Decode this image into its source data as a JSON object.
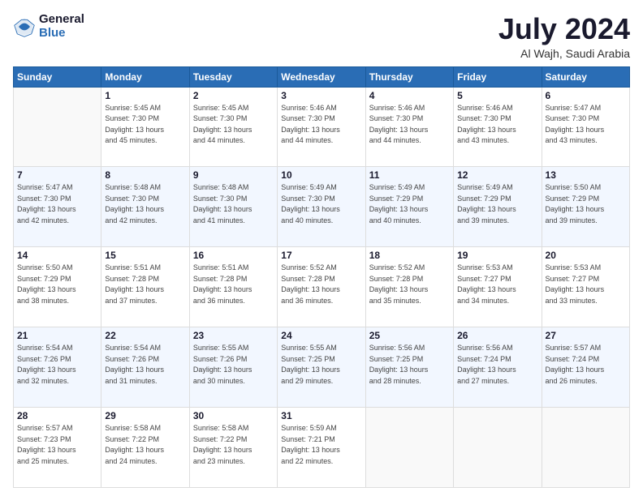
{
  "logo": {
    "general": "General",
    "blue": "Blue"
  },
  "title": "July 2024",
  "subtitle": "Al Wajh, Saudi Arabia",
  "days_header": [
    "Sunday",
    "Monday",
    "Tuesday",
    "Wednesday",
    "Thursday",
    "Friday",
    "Saturday"
  ],
  "weeks": [
    [
      {
        "day": "",
        "info": ""
      },
      {
        "day": "1",
        "info": "Sunrise: 5:45 AM\nSunset: 7:30 PM\nDaylight: 13 hours\nand 45 minutes."
      },
      {
        "day": "2",
        "info": "Sunrise: 5:45 AM\nSunset: 7:30 PM\nDaylight: 13 hours\nand 44 minutes."
      },
      {
        "day": "3",
        "info": "Sunrise: 5:46 AM\nSunset: 7:30 PM\nDaylight: 13 hours\nand 44 minutes."
      },
      {
        "day": "4",
        "info": "Sunrise: 5:46 AM\nSunset: 7:30 PM\nDaylight: 13 hours\nand 44 minutes."
      },
      {
        "day": "5",
        "info": "Sunrise: 5:46 AM\nSunset: 7:30 PM\nDaylight: 13 hours\nand 43 minutes."
      },
      {
        "day": "6",
        "info": "Sunrise: 5:47 AM\nSunset: 7:30 PM\nDaylight: 13 hours\nand 43 minutes."
      }
    ],
    [
      {
        "day": "7",
        "info": "Sunrise: 5:47 AM\nSunset: 7:30 PM\nDaylight: 13 hours\nand 42 minutes."
      },
      {
        "day": "8",
        "info": "Sunrise: 5:48 AM\nSunset: 7:30 PM\nDaylight: 13 hours\nand 42 minutes."
      },
      {
        "day": "9",
        "info": "Sunrise: 5:48 AM\nSunset: 7:30 PM\nDaylight: 13 hours\nand 41 minutes."
      },
      {
        "day": "10",
        "info": "Sunrise: 5:49 AM\nSunset: 7:30 PM\nDaylight: 13 hours\nand 40 minutes."
      },
      {
        "day": "11",
        "info": "Sunrise: 5:49 AM\nSunset: 7:29 PM\nDaylight: 13 hours\nand 40 minutes."
      },
      {
        "day": "12",
        "info": "Sunrise: 5:49 AM\nSunset: 7:29 PM\nDaylight: 13 hours\nand 39 minutes."
      },
      {
        "day": "13",
        "info": "Sunrise: 5:50 AM\nSunset: 7:29 PM\nDaylight: 13 hours\nand 39 minutes."
      }
    ],
    [
      {
        "day": "14",
        "info": "Sunrise: 5:50 AM\nSunset: 7:29 PM\nDaylight: 13 hours\nand 38 minutes."
      },
      {
        "day": "15",
        "info": "Sunrise: 5:51 AM\nSunset: 7:28 PM\nDaylight: 13 hours\nand 37 minutes."
      },
      {
        "day": "16",
        "info": "Sunrise: 5:51 AM\nSunset: 7:28 PM\nDaylight: 13 hours\nand 36 minutes."
      },
      {
        "day": "17",
        "info": "Sunrise: 5:52 AM\nSunset: 7:28 PM\nDaylight: 13 hours\nand 36 minutes."
      },
      {
        "day": "18",
        "info": "Sunrise: 5:52 AM\nSunset: 7:28 PM\nDaylight: 13 hours\nand 35 minutes."
      },
      {
        "day": "19",
        "info": "Sunrise: 5:53 AM\nSunset: 7:27 PM\nDaylight: 13 hours\nand 34 minutes."
      },
      {
        "day": "20",
        "info": "Sunrise: 5:53 AM\nSunset: 7:27 PM\nDaylight: 13 hours\nand 33 minutes."
      }
    ],
    [
      {
        "day": "21",
        "info": "Sunrise: 5:54 AM\nSunset: 7:26 PM\nDaylight: 13 hours\nand 32 minutes."
      },
      {
        "day": "22",
        "info": "Sunrise: 5:54 AM\nSunset: 7:26 PM\nDaylight: 13 hours\nand 31 minutes."
      },
      {
        "day": "23",
        "info": "Sunrise: 5:55 AM\nSunset: 7:26 PM\nDaylight: 13 hours\nand 30 minutes."
      },
      {
        "day": "24",
        "info": "Sunrise: 5:55 AM\nSunset: 7:25 PM\nDaylight: 13 hours\nand 29 minutes."
      },
      {
        "day": "25",
        "info": "Sunrise: 5:56 AM\nSunset: 7:25 PM\nDaylight: 13 hours\nand 28 minutes."
      },
      {
        "day": "26",
        "info": "Sunrise: 5:56 AM\nSunset: 7:24 PM\nDaylight: 13 hours\nand 27 minutes."
      },
      {
        "day": "27",
        "info": "Sunrise: 5:57 AM\nSunset: 7:24 PM\nDaylight: 13 hours\nand 26 minutes."
      }
    ],
    [
      {
        "day": "28",
        "info": "Sunrise: 5:57 AM\nSunset: 7:23 PM\nDaylight: 13 hours\nand 25 minutes."
      },
      {
        "day": "29",
        "info": "Sunrise: 5:58 AM\nSunset: 7:22 PM\nDaylight: 13 hours\nand 24 minutes."
      },
      {
        "day": "30",
        "info": "Sunrise: 5:58 AM\nSunset: 7:22 PM\nDaylight: 13 hours\nand 23 minutes."
      },
      {
        "day": "31",
        "info": "Sunrise: 5:59 AM\nSunset: 7:21 PM\nDaylight: 13 hours\nand 22 minutes."
      },
      {
        "day": "",
        "info": ""
      },
      {
        "day": "",
        "info": ""
      },
      {
        "day": "",
        "info": ""
      }
    ]
  ]
}
